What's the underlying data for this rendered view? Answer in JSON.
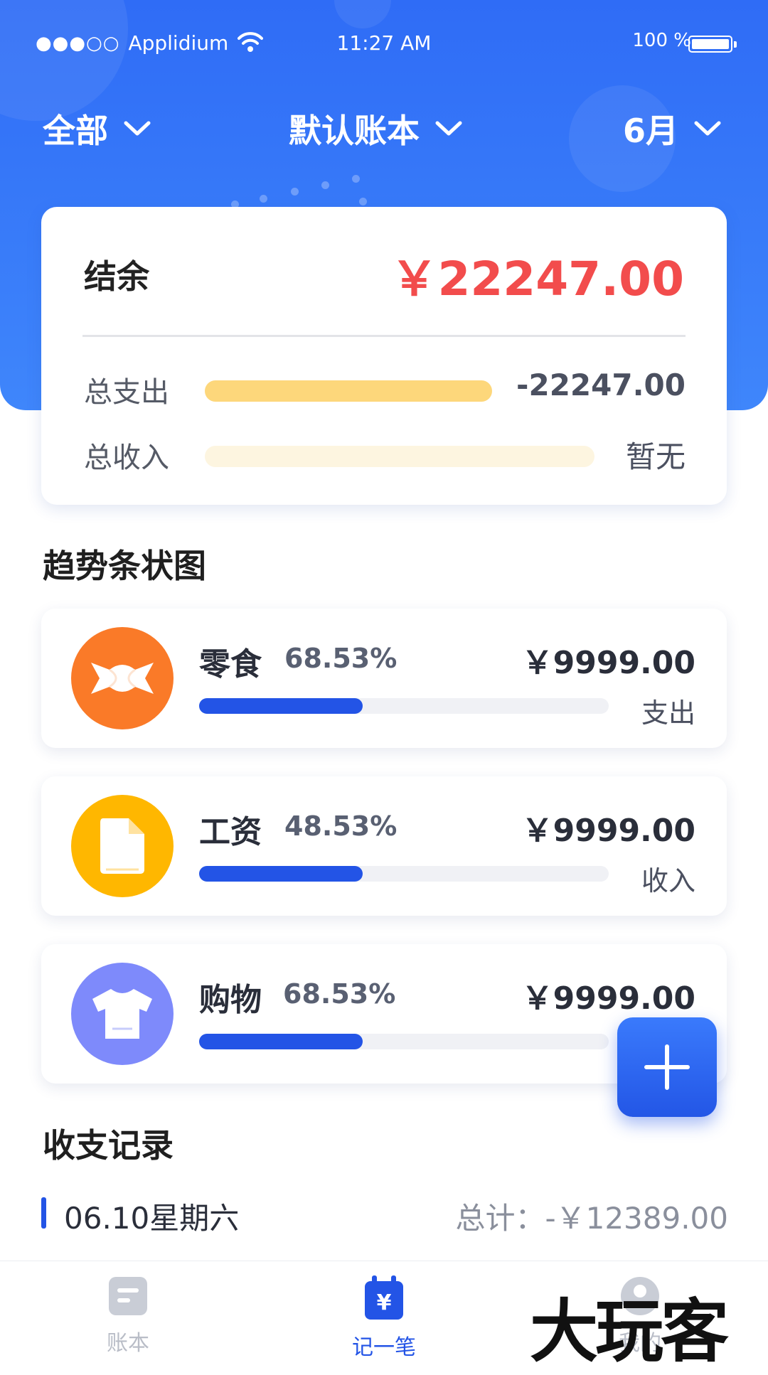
{
  "status_bar": {
    "signal": "●●●○○",
    "carrier": "Applidium",
    "time": "11:27 AM",
    "battery": "100 %"
  },
  "filters": {
    "scope": "全部",
    "book": "默认账本",
    "month": "6月"
  },
  "summary": {
    "balance_label": "结余",
    "balance_value": "￥22247.00",
    "expense_label": "总支出",
    "expense_value": "-22247.00",
    "expense_fill": 0.7,
    "income_label": "总收入",
    "income_value": "暂无",
    "income_fill": 0.0,
    "colors": {
      "expense_bar": "#fdd77b",
      "income_track": "#fdf5e0",
      "balance": "#f24c4c"
    }
  },
  "trend": {
    "title": "趋势条状图",
    "items": [
      {
        "name": "零食",
        "percent": "68.53%",
        "amount": "￥9999.00",
        "type": "支出",
        "fill": 0.4,
        "icon": "candy-icon",
        "color": "#fa7a28"
      },
      {
        "name": "工资",
        "percent": "48.53%",
        "amount": "￥9999.00",
        "type": "收入",
        "fill": 0.4,
        "icon": "document-icon",
        "color": "#ffb700"
      },
      {
        "name": "购物",
        "percent": "68.53%",
        "amount": "￥9999.00",
        "type": "",
        "fill": 0.4,
        "icon": "shirt-icon",
        "color": "#7e8afb"
      }
    ]
  },
  "records": {
    "title": "收支记录",
    "date": "06.10星期六",
    "total": "总计：-￥12389.00"
  },
  "tabbar": {
    "items": [
      {
        "label": "账本",
        "icon": "ledger-icon",
        "active": false
      },
      {
        "label": "记一笔",
        "icon": "yen-calendar-icon",
        "active": true
      },
      {
        "label": "我的",
        "icon": "user-icon",
        "active": false
      }
    ]
  },
  "watermark": "大玩客"
}
